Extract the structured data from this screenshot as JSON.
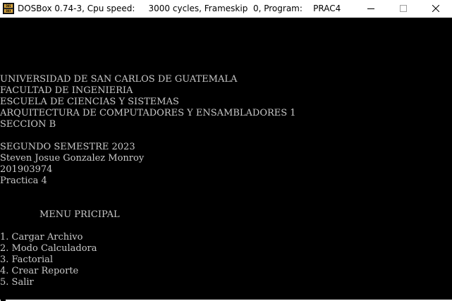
{
  "window": {
    "app_name": "DOSBox 0.74-3, Cpu speed:",
    "cycles": "3000 cycles, Frameskip",
    "frameskip": "0, Program:",
    "program": "PRAC4",
    "icon_top": "DOS",
    "icon_bottom": "BOX",
    "icon": "dosbox-icon"
  },
  "console": {
    "text_color": "#c8c8c8",
    "background": "#000000",
    "header_lines": [
      "UNIVERSIDAD DE SAN CARLOS DE GUATEMALA",
      "FACULTAD DE INGENIERIA",
      "ESCUELA DE CIENCIAS Y SISTEMAS",
      "ARQUITECTURA DE COMPUTADORES Y ENSAMBLADORES 1",
      "SECCION B"
    ],
    "student_lines": [
      "SEGUNDO SEMESTRE 2023",
      "Steven Josue Gonzalez Monroy",
      "201903974",
      "Practica 4"
    ],
    "menu_title": "MENU PRICIPAL",
    "menu_items": [
      "1. Cargar Archivo",
      "2. Modo Calculadora",
      "3. Factorial",
      "4. Crear Reporte",
      "5. Salir"
    ]
  }
}
